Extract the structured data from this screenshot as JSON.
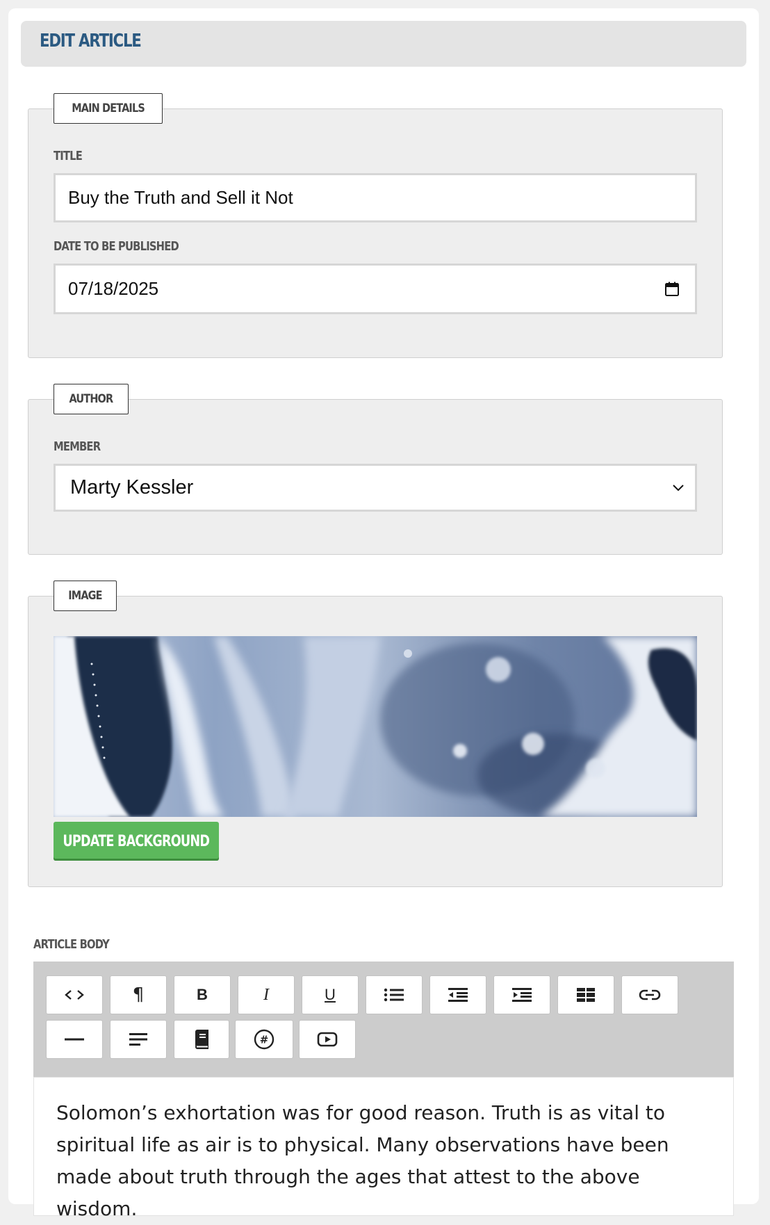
{
  "header": {
    "title": "EDIT ARTICLE"
  },
  "main_details": {
    "legend": "MAIN DETAILS",
    "title_label": "TITLE",
    "title_value": "Buy the Truth and Sell it Not",
    "date_label": "DATE TO BE PUBLISHED",
    "date_value": "07/18/2025"
  },
  "author": {
    "legend": "AUTHOR",
    "member_label": "MEMBER",
    "member_value": "Marty Kessler"
  },
  "image": {
    "legend": "IMAGE",
    "update_button": "UPDATE BACKGROUND"
  },
  "article_body": {
    "label": "ARTICLE BODY",
    "toolbar": [
      {
        "icon": "code-view-icon",
        "glyph": "<>"
      },
      {
        "icon": "paragraph-icon",
        "glyph": "¶"
      },
      {
        "icon": "bold-icon",
        "glyph": "B"
      },
      {
        "icon": "italic-icon",
        "glyph": "I"
      },
      {
        "icon": "underline-icon",
        "glyph": "U"
      },
      {
        "icon": "bulleted-list-icon",
        "glyph": ""
      },
      {
        "icon": "outdent-icon",
        "glyph": ""
      },
      {
        "icon": "indent-icon",
        "glyph": ""
      },
      {
        "icon": "table-icon",
        "glyph": ""
      },
      {
        "icon": "link-icon",
        "glyph": ""
      },
      {
        "icon": "horizontal-rule-icon",
        "glyph": ""
      },
      {
        "icon": "align-left-icon",
        "glyph": ""
      },
      {
        "icon": "book-icon",
        "glyph": ""
      },
      {
        "icon": "hashtag-icon",
        "glyph": "#"
      },
      {
        "icon": "video-icon",
        "glyph": ""
      }
    ],
    "text": "Solomon’s exhortation was for good reason. Truth is as vital to spiritual life as air is to physical. Many observations have been made about truth through the ages that attest to the above wisdom."
  }
}
